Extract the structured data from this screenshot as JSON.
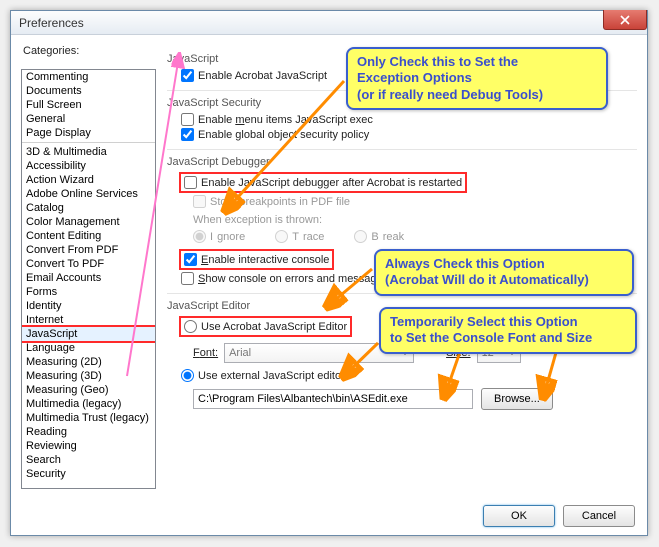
{
  "window": {
    "title": "Preferences"
  },
  "categories_label": "Categories:",
  "categories": [
    "Commenting",
    "Documents",
    "Full Screen",
    "General",
    "Page Display",
    "__sep__",
    "3D & Multimedia",
    "Accessibility",
    "Action Wizard",
    "Adobe Online Services",
    "Catalog",
    "Color Management",
    "Content Editing",
    "Convert From PDF",
    "Convert To PDF",
    "Email Accounts",
    "Forms",
    "Identity",
    "Internet",
    "JavaScript",
    "Language",
    "Measuring (2D)",
    "Measuring (3D)",
    "Measuring (Geo)",
    "Multimedia (legacy)",
    "Multimedia Trust (legacy)",
    "Reading",
    "Reviewing",
    "Search",
    "Security"
  ],
  "selected_category": "JavaScript",
  "js": {
    "header": "JavaScript",
    "enable_acrobat_js": "Enable Acrobat JavaScript",
    "security_header": "JavaScript Security",
    "enable_menu_items": "Enable menu items JavaScript exec",
    "enable_global_security": "Enable global object security policy",
    "debugger_header": "JavaScript Debugger",
    "enable_debugger": "Enable JavaScript debugger after Acrobat is restarted",
    "store_breakpoints": "Store breakpoints in PDF file",
    "when_exception": "When exception is thrown:",
    "ignore": "Ignore",
    "trace": "Trace",
    "break": "Break",
    "enable_interactive": "Enable interactive console",
    "show_console_err": "Show console on errors and messages",
    "editor_header": "JavaScript Editor",
    "use_acrobat_editor": "Use Acrobat JavaScript Editor",
    "font_label": "Font:",
    "font_value": "Arial",
    "size_label": "Size:",
    "size_value": "12",
    "use_external_editor": "Use external JavaScript editor",
    "external_path": "C:\\Program Files\\Albantech\\bin\\ASEdit.exe",
    "browse": "Browse..."
  },
  "buttons": {
    "ok": "OK",
    "cancel": "Cancel"
  },
  "callouts": {
    "c1_l1": "Only Check this to Set the",
    "c1_l2": "Exception Options",
    "c1_l3": "(or if really need Debug Tools)",
    "c2_l1": "Always Check this Option",
    "c2_l2": "(Acrobat Will do it Automatically)",
    "c3_l1": "Temporarily Select this Option",
    "c3_l2": "to Set the Console Font and Size"
  }
}
